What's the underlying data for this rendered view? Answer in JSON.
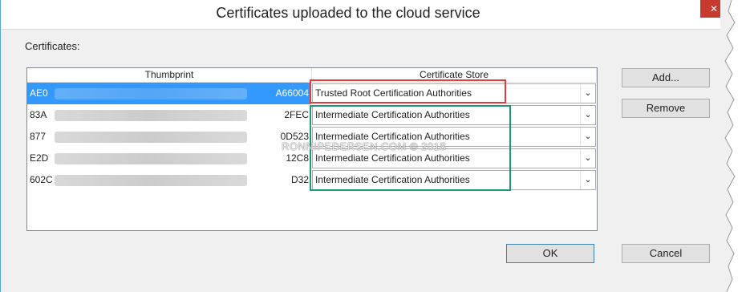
{
  "window": {
    "title": "Certificates uploaded to the cloud service",
    "close_glyph": "✕"
  },
  "certificates_label": "Certificates:",
  "grid": {
    "columns": [
      "Thumbprint",
      "Certificate Store"
    ],
    "rows": [
      {
        "thumb_prefix": "AE0",
        "thumb_suffix": "A66004",
        "store": "Trusted Root Certification Authorities",
        "selected": true
      },
      {
        "thumb_prefix": "83A",
        "thumb_suffix": "2FEC",
        "store": "Intermediate Certification Authorities",
        "selected": false
      },
      {
        "thumb_prefix": "877",
        "thumb_suffix": "0D523",
        "store": "Intermediate Certification Authorities",
        "selected": false
      },
      {
        "thumb_prefix": "E2D",
        "thumb_suffix": "12C8",
        "store": "Intermediate Certification Authorities",
        "selected": false
      },
      {
        "thumb_prefix": "602C",
        "thumb_suffix": "D32",
        "store": "Intermediate Certification Authorities",
        "selected": false
      }
    ],
    "dropdown_glyph": "⌄"
  },
  "buttons": {
    "add": "Add...",
    "remove": "Remove",
    "ok": "OK",
    "cancel": "Cancel"
  },
  "watermark": "RONNIPEDERSEN.COM © 2018",
  "colors": {
    "selection": "#3399ff",
    "highlight_red": "#e23c3c",
    "highlight_green": "#1e9a7a",
    "close_red": "#c83a30"
  }
}
